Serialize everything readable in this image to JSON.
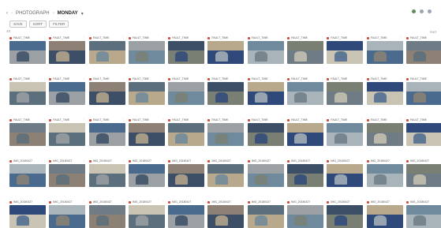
{
  "breadcrumb": [
    "PHOTOGRAPH",
    "MONDAY"
  ],
  "toolbar": [
    "SAVE",
    "SORT",
    "FILTER"
  ],
  "count": "49",
  "sort": "Sort",
  "rows": [
    {
      "label": "FAULT_TIME",
      "tiles": 11
    },
    {
      "label": "FAULT_TIME",
      "tiles": 11
    },
    {
      "label": "FAULT_TIME",
      "tiles": 11
    },
    {
      "label": "IMG_20180427",
      "tiles": 11
    },
    {
      "label": "IMG_20180427",
      "tiles": 11
    }
  ],
  "palette": [
    "#9aa0a3",
    "#6f7c86",
    "#b8a88c",
    "#4a6a8e",
    "#7a7f74",
    "#5c6f7d",
    "#a9b3ba",
    "#3d4f66",
    "#c9c3b3",
    "#6e8a9c",
    "#8c8174",
    "#2f4a7a"
  ]
}
